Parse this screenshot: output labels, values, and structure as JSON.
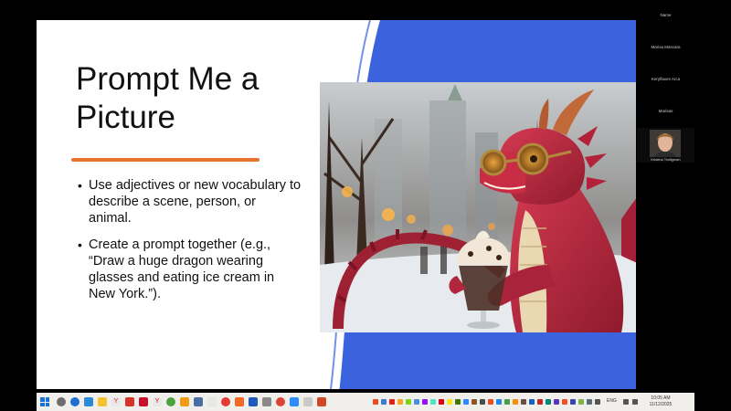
{
  "slide": {
    "title": "Prompt Me a Picture",
    "bullets": [
      "Use adjectives or new vocabulary to describe a scene, person, or animal.",
      "Create a prompt together (e.g., “Draw a huge dragon wearing glasses and eating ice cream in New York.”)."
    ],
    "accent_color": "#3b63dd",
    "underline_color": "#e8732e"
  },
  "participants": [
    {
      "name": "Name"
    },
    {
      "name": "Marisa Mascara"
    },
    {
      "name": "Keryflaxes Arca"
    },
    {
      "name": "Marisas"
    },
    {
      "name": "Kristina Trafigrosn"
    }
  ],
  "taskbar": {
    "tray": {
      "language": "ENG"
    },
    "clock": {
      "time": "10:05 AM",
      "date": "11/12/2025"
    }
  }
}
